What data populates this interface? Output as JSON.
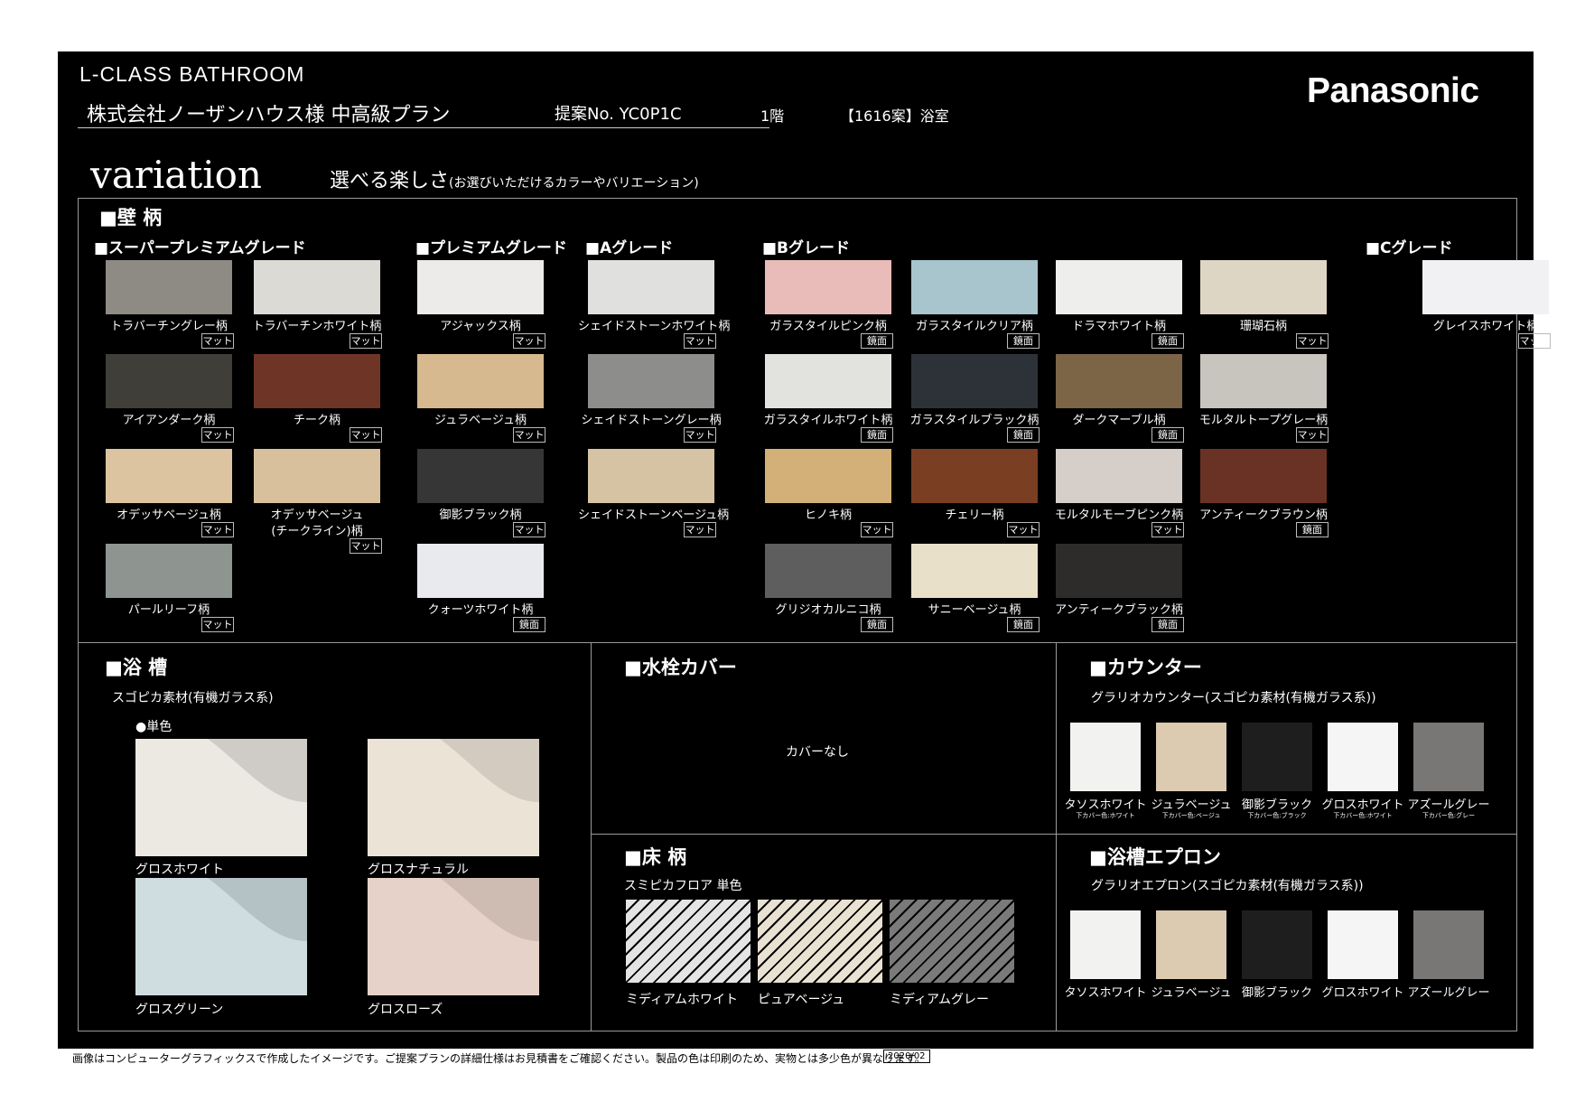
{
  "header": {
    "series": "L-CLASS  BATHROOM",
    "customer": "株式会社ノーザンハウス様  中高級プラン",
    "proposal_no": "提案No.  YC0P1C",
    "floor": "1階",
    "plan": "【1616案】浴室",
    "brand": "Panasonic",
    "section_title": "variation",
    "section_subtitle": "選べる楽しさ",
    "section_subtitle_note": "(お選びいただけるカラーやバリエーション)"
  },
  "wall": {
    "heading": "■壁 柄",
    "grades": {
      "super": "■スーパープレミアムグレード",
      "premium": "■プレミアムグレード",
      "a": "■Aグレード",
      "b": "■Bグレード",
      "c": "■Cグレード"
    },
    "swatches": [
      {
        "name": "トラバーチングレー柄",
        "finish": "マット",
        "color": "#8e8a84"
      },
      {
        "name": "トラバーチンホワイト柄",
        "finish": "マット",
        "color": "#dcdad5"
      },
      {
        "name": "アイアンダーク柄",
        "finish": "マット",
        "color": "#3f3e38"
      },
      {
        "name": "チーク柄",
        "finish": "マット",
        "color": "#6e3526"
      },
      {
        "name": "オデッサベージュ柄",
        "finish": "マット",
        "color": "#dcc4a0"
      },
      {
        "name": "オデッサベージュ",
        "name2": "(チークライン)柄",
        "finish": "マット",
        "color": "#d8c09c"
      },
      {
        "name": "パールリーフ柄",
        "finish": "マット",
        "color": "#8e9591"
      },
      {
        "name": "アジャックス柄",
        "finish": "マット",
        "color": "#ecebea"
      },
      {
        "name": "ジュラベージュ柄",
        "finish": "マット",
        "color": "#d6b98f"
      },
      {
        "name": "御影ブラック柄",
        "finish": "マット",
        "color": "#363636"
      },
      {
        "name": "クォーツホワイト柄",
        "finish": "鏡面",
        "color": "#e8eaee"
      },
      {
        "name": "シェイドストーンホワイト柄",
        "finish": "マット",
        "color": "#e0e0de"
      },
      {
        "name": "シェイドストーングレー柄",
        "finish": "マット",
        "color": "#8d8d8b"
      },
      {
        "name": "シェイドストーンベージュ柄",
        "finish": "マット",
        "color": "#d5c3a4"
      },
      {
        "name": "ガラスタイルピンク柄",
        "finish": "鏡面",
        "color": "#e9bcba"
      },
      {
        "name": "ガラスタイルクリア柄",
        "finish": "鏡面",
        "color": "#a8c5cd"
      },
      {
        "name": "ドラマホワイト柄",
        "finish": "鏡面",
        "color": "#eeeeec"
      },
      {
        "name": "珊瑚石柄",
        "finish": "マット",
        "color": "#ddd6c4"
      },
      {
        "name": "ガラスタイルホワイト柄",
        "finish": "鏡面",
        "color": "#e2e2de"
      },
      {
        "name": "ガラスタイルブラック柄",
        "finish": "鏡面",
        "color": "#2d3238"
      },
      {
        "name": "ダークマーブル柄",
        "finish": "鏡面",
        "color": "#7c6446"
      },
      {
        "name": "モルタルトープグレー柄",
        "finish": "マット",
        "color": "#c8c4be"
      },
      {
        "name": "ヒノキ柄",
        "finish": "マット",
        "color": "#d3b078"
      },
      {
        "name": "チェリー柄",
        "finish": "マット",
        "color": "#7a3f22"
      },
      {
        "name": "モルタルモーブピンク柄",
        "finish": "マット",
        "color": "#d6cec9"
      },
      {
        "name": "アンティークブラウン柄",
        "finish": "鏡面",
        "color": "#6a3224"
      },
      {
        "name": "グリジオカルニコ柄",
        "finish": "鏡面",
        "color": "#5e5e5e"
      },
      {
        "name": "サニーベージュ柄",
        "finish": "鏡面",
        "color": "#e8e0c8"
      },
      {
        "name": "アンティークブラック柄",
        "finish": "鏡面",
        "color": "#2e2c2a"
      },
      {
        "name": "グレイスホワイト柄",
        "finish": "マット",
        "color": "#f1f1f3"
      }
    ]
  },
  "bathtub": {
    "heading": "■浴 槽",
    "material": "スゴピカ素材(有機ガラス系)",
    "type": "●単色",
    "colors": [
      {
        "name": "グロスホワイト",
        "color": "#ece8e2"
      },
      {
        "name": "グロスナチュラル",
        "color": "#ebe3d6"
      },
      {
        "name": "グロスグリーン",
        "color": "#cfdde1"
      },
      {
        "name": "グロスローズ",
        "color": "#e6d2c8"
      }
    ]
  },
  "faucet": {
    "heading": "■水栓カバー",
    "value": "カバーなし"
  },
  "floor": {
    "heading": "■床 柄",
    "material": "スミピカフロア  単色",
    "colors": [
      {
        "name": "ミディアムホワイト",
        "color": "#e4e4e4"
      },
      {
        "name": "ピュアベージュ",
        "color": "#e9e2d2"
      },
      {
        "name": "ミディアムグレー",
        "color": "#7a7a7a"
      }
    ]
  },
  "counter": {
    "heading": "■カウンター",
    "material": "グラリオカウンター(スゴピカ素材(有機ガラス系))",
    "colors": [
      {
        "name": "タソスホワイト",
        "sub": "下カバー色:ホワイト",
        "color": "#f2f2f0"
      },
      {
        "name": "ジュラベージュ",
        "sub": "下カバー色:ベージュ",
        "color": "#dccbb0"
      },
      {
        "name": "御影ブラック",
        "sub": "下カバー色:ブラック",
        "color": "#1e1e1e"
      },
      {
        "name": "グロスホワイト",
        "sub": "下カバー色:ホワイト",
        "color": "#f5f5f5"
      },
      {
        "name": "アズールグレー",
        "sub": "下カバー色:グレー",
        "color": "#797775"
      }
    ]
  },
  "apron": {
    "heading": "■浴槽エプロン",
    "material": "グラリオエプロン(スゴピカ素材(有機ガラス系))",
    "colors": [
      {
        "name": "タソスホワイト",
        "color": "#f2f2f0"
      },
      {
        "name": "ジュラベージュ",
        "color": "#dccbb0"
      },
      {
        "name": "御影ブラック",
        "color": "#1e1e1e"
      },
      {
        "name": "グロスホワイト",
        "color": "#f5f5f5"
      },
      {
        "name": "アズールグレー",
        "color": "#797775"
      }
    ]
  },
  "footer": {
    "note": "画像はコンピューターグラフィックスで作成したイメージです。ご提案プランの詳細仕様はお見積書をご確認ください。製品の色は印刷のため、実物とは多少色が異なります。",
    "date": "2020/02"
  }
}
